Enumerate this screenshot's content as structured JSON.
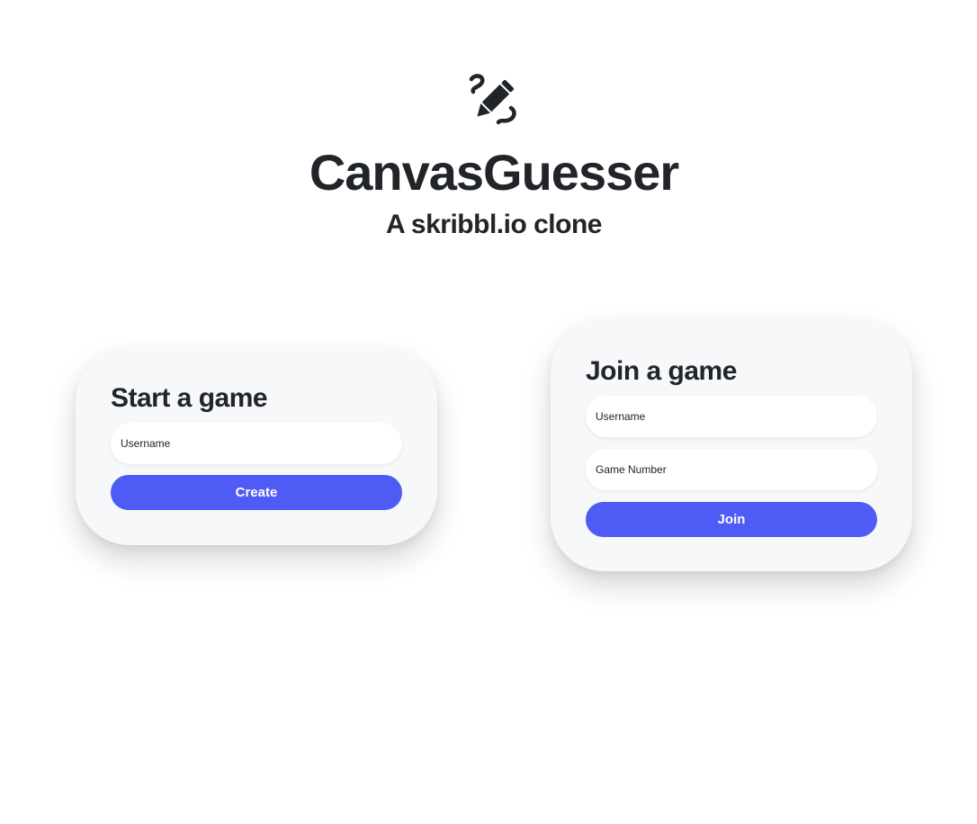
{
  "header": {
    "logo_icon": "pencil-scribble-icon",
    "title": "CanvasGuesser",
    "subtitle": "A skribbl.io clone"
  },
  "start_card": {
    "title": "Start a game",
    "username_placeholder": "Username",
    "button_label": "Create"
  },
  "join_card": {
    "title": "Join a game",
    "username_placeholder": "Username",
    "game_number_placeholder": "Game Number",
    "button_label": "Join"
  },
  "colors": {
    "accent": "#4f5bf5",
    "text": "#212529",
    "card_bg": "#f7f8fa",
    "page_bg": "#ffffff"
  }
}
